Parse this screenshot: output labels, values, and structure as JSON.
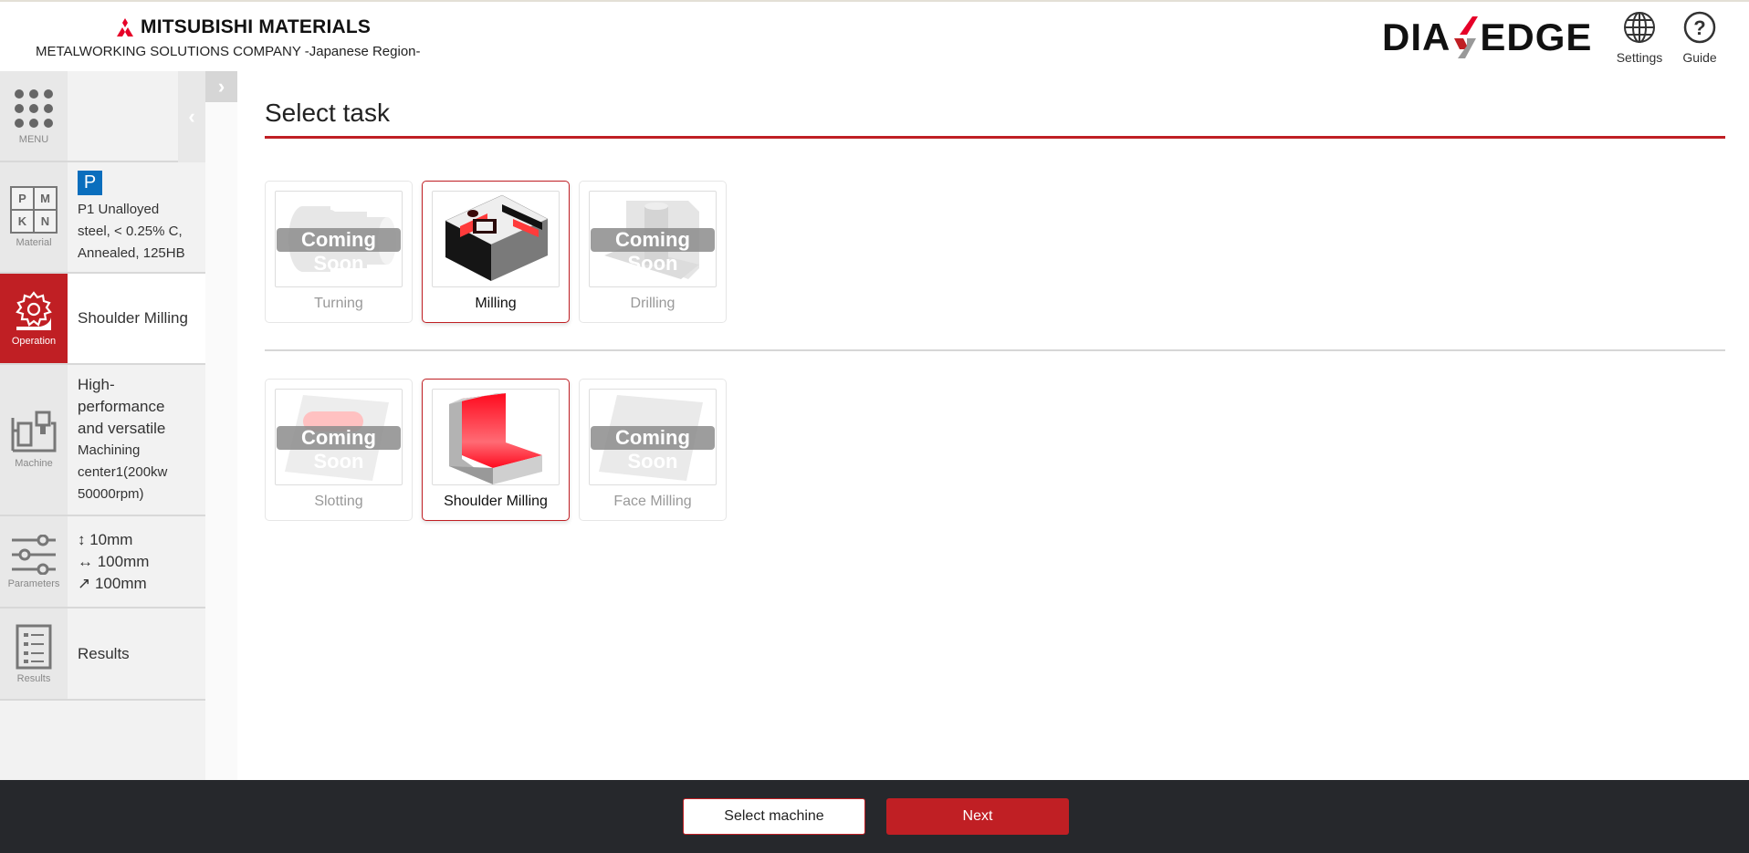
{
  "header": {
    "brand": "MITSUBISHI MATERIALS",
    "company": "METALWORKING SOLUTIONS COMPANY -Japanese Region-",
    "product_logo_left": "DIA",
    "product_logo_right": "EDGE",
    "settings_label": "Settings",
    "guide_label": "Guide",
    "accent_color": "#c01f24"
  },
  "sidebar": {
    "menu_label": "MENU",
    "items": [
      {
        "key": "material",
        "caption": "Material",
        "badge": "P",
        "lines": [
          "P1 Unalloyed",
          "steel, < 0.25% C,",
          "Annealed, 125HB"
        ],
        "icon_letters": [
          "P",
          "M",
          "K",
          "N"
        ]
      },
      {
        "key": "operation",
        "caption": "Operation",
        "text": "Shoulder Milling",
        "active": true
      },
      {
        "key": "machine",
        "caption": "Machine",
        "lines": [
          "High-",
          "performance",
          "and versatile",
          "Machining",
          "center1(200kw",
          "50000rpm)"
        ]
      },
      {
        "key": "parameters",
        "caption": "Parameters",
        "lines": [
          "↕ 10mm",
          "↔ 100mm",
          "↗ 100mm"
        ]
      },
      {
        "key": "results",
        "caption": "Results",
        "text": "Results"
      }
    ]
  },
  "main": {
    "title": "Select task",
    "coming_soon_label": "Coming Soon",
    "task_rows": [
      [
        {
          "name": "Turning",
          "status": "coming-soon"
        },
        {
          "name": "Milling",
          "status": "selected"
        },
        {
          "name": "Drilling",
          "status": "coming-soon"
        }
      ],
      [
        {
          "name": "Slotting",
          "status": "coming-soon"
        },
        {
          "name": "Shoulder Milling",
          "status": "selected"
        },
        {
          "name": "Face Milling",
          "status": "coming-soon"
        }
      ]
    ]
  },
  "footer": {
    "back_label": "Select machine",
    "next_label": "Next"
  }
}
